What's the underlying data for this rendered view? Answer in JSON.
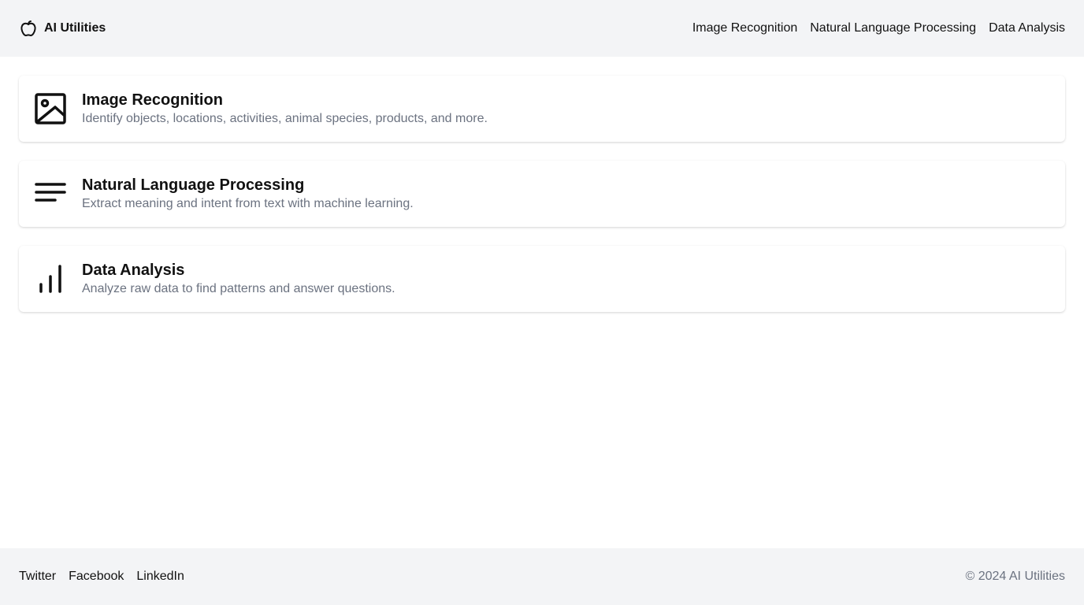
{
  "header": {
    "brand_icon": "apple-icon",
    "brand_name": "AI Utilities",
    "nav": [
      {
        "label": "Image Recognition"
      },
      {
        "label": "Natural Language Processing"
      },
      {
        "label": "Data Analysis"
      }
    ]
  },
  "cards": [
    {
      "icon": "image-icon",
      "title": "Image Recognition",
      "description": "Identify objects, locations, activities, animal species, products, and more."
    },
    {
      "icon": "text-lines-icon",
      "title": "Natural Language Processing",
      "description": "Extract meaning and intent from text with machine learning."
    },
    {
      "icon": "bar-chart-icon",
      "title": "Data Analysis",
      "description": "Analyze raw data to find patterns and answer questions."
    }
  ],
  "footer": {
    "social": [
      {
        "label": "Twitter"
      },
      {
        "label": "Facebook"
      },
      {
        "label": "LinkedIn"
      }
    ],
    "copyright": "© 2024 AI Utilities"
  },
  "colors": {
    "header_bg": "#f3f4f6",
    "text": "#111111",
    "muted_text": "#6b7280"
  }
}
